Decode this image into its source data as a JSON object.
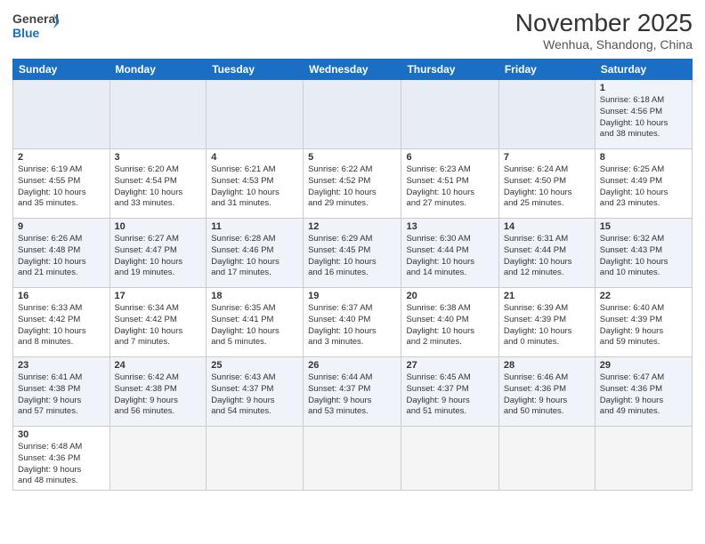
{
  "logo": {
    "general": "General",
    "blue": "Blue"
  },
  "header": {
    "month": "November 2025",
    "location": "Wenhua, Shandong, China"
  },
  "days_of_week": [
    "Sunday",
    "Monday",
    "Tuesday",
    "Wednesday",
    "Thursday",
    "Friday",
    "Saturday"
  ],
  "weeks": [
    [
      {
        "day": "",
        "info": ""
      },
      {
        "day": "",
        "info": ""
      },
      {
        "day": "",
        "info": ""
      },
      {
        "day": "",
        "info": ""
      },
      {
        "day": "",
        "info": ""
      },
      {
        "day": "",
        "info": ""
      },
      {
        "day": "1",
        "info": "Sunrise: 6:18 AM\nSunset: 4:56 PM\nDaylight: 10 hours\nand 38 minutes."
      }
    ],
    [
      {
        "day": "2",
        "info": "Sunrise: 6:19 AM\nSunset: 4:55 PM\nDaylight: 10 hours\nand 35 minutes."
      },
      {
        "day": "3",
        "info": "Sunrise: 6:20 AM\nSunset: 4:54 PM\nDaylight: 10 hours\nand 33 minutes."
      },
      {
        "day": "4",
        "info": "Sunrise: 6:21 AM\nSunset: 4:53 PM\nDaylight: 10 hours\nand 31 minutes."
      },
      {
        "day": "5",
        "info": "Sunrise: 6:22 AM\nSunset: 4:52 PM\nDaylight: 10 hours\nand 29 minutes."
      },
      {
        "day": "6",
        "info": "Sunrise: 6:23 AM\nSunset: 4:51 PM\nDaylight: 10 hours\nand 27 minutes."
      },
      {
        "day": "7",
        "info": "Sunrise: 6:24 AM\nSunset: 4:50 PM\nDaylight: 10 hours\nand 25 minutes."
      },
      {
        "day": "8",
        "info": "Sunrise: 6:25 AM\nSunset: 4:49 PM\nDaylight: 10 hours\nand 23 minutes."
      }
    ],
    [
      {
        "day": "9",
        "info": "Sunrise: 6:26 AM\nSunset: 4:48 PM\nDaylight: 10 hours\nand 21 minutes."
      },
      {
        "day": "10",
        "info": "Sunrise: 6:27 AM\nSunset: 4:47 PM\nDaylight: 10 hours\nand 19 minutes."
      },
      {
        "day": "11",
        "info": "Sunrise: 6:28 AM\nSunset: 4:46 PM\nDaylight: 10 hours\nand 17 minutes."
      },
      {
        "day": "12",
        "info": "Sunrise: 6:29 AM\nSunset: 4:45 PM\nDaylight: 10 hours\nand 16 minutes."
      },
      {
        "day": "13",
        "info": "Sunrise: 6:30 AM\nSunset: 4:44 PM\nDaylight: 10 hours\nand 14 minutes."
      },
      {
        "day": "14",
        "info": "Sunrise: 6:31 AM\nSunset: 4:44 PM\nDaylight: 10 hours\nand 12 minutes."
      },
      {
        "day": "15",
        "info": "Sunrise: 6:32 AM\nSunset: 4:43 PM\nDaylight: 10 hours\nand 10 minutes."
      }
    ],
    [
      {
        "day": "16",
        "info": "Sunrise: 6:33 AM\nSunset: 4:42 PM\nDaylight: 10 hours\nand 8 minutes."
      },
      {
        "day": "17",
        "info": "Sunrise: 6:34 AM\nSunset: 4:42 PM\nDaylight: 10 hours\nand 7 minutes."
      },
      {
        "day": "18",
        "info": "Sunrise: 6:35 AM\nSunset: 4:41 PM\nDaylight: 10 hours\nand 5 minutes."
      },
      {
        "day": "19",
        "info": "Sunrise: 6:37 AM\nSunset: 4:40 PM\nDaylight: 10 hours\nand 3 minutes."
      },
      {
        "day": "20",
        "info": "Sunrise: 6:38 AM\nSunset: 4:40 PM\nDaylight: 10 hours\nand 2 minutes."
      },
      {
        "day": "21",
        "info": "Sunrise: 6:39 AM\nSunset: 4:39 PM\nDaylight: 10 hours\nand 0 minutes."
      },
      {
        "day": "22",
        "info": "Sunrise: 6:40 AM\nSunset: 4:39 PM\nDaylight: 9 hours\nand 59 minutes."
      }
    ],
    [
      {
        "day": "23",
        "info": "Sunrise: 6:41 AM\nSunset: 4:38 PM\nDaylight: 9 hours\nand 57 minutes."
      },
      {
        "day": "24",
        "info": "Sunrise: 6:42 AM\nSunset: 4:38 PM\nDaylight: 9 hours\nand 56 minutes."
      },
      {
        "day": "25",
        "info": "Sunrise: 6:43 AM\nSunset: 4:37 PM\nDaylight: 9 hours\nand 54 minutes."
      },
      {
        "day": "26",
        "info": "Sunrise: 6:44 AM\nSunset: 4:37 PM\nDaylight: 9 hours\nand 53 minutes."
      },
      {
        "day": "27",
        "info": "Sunrise: 6:45 AM\nSunset: 4:37 PM\nDaylight: 9 hours\nand 51 minutes."
      },
      {
        "day": "28",
        "info": "Sunrise: 6:46 AM\nSunset: 4:36 PM\nDaylight: 9 hours\nand 50 minutes."
      },
      {
        "day": "29",
        "info": "Sunrise: 6:47 AM\nSunset: 4:36 PM\nDaylight: 9 hours\nand 49 minutes."
      }
    ],
    [
      {
        "day": "30",
        "info": "Sunrise: 6:48 AM\nSunset: 4:36 PM\nDaylight: 9 hours\nand 48 minutes."
      },
      {
        "day": "",
        "info": ""
      },
      {
        "day": "",
        "info": ""
      },
      {
        "day": "",
        "info": ""
      },
      {
        "day": "",
        "info": ""
      },
      {
        "day": "",
        "info": ""
      },
      {
        "day": "",
        "info": ""
      }
    ]
  ]
}
